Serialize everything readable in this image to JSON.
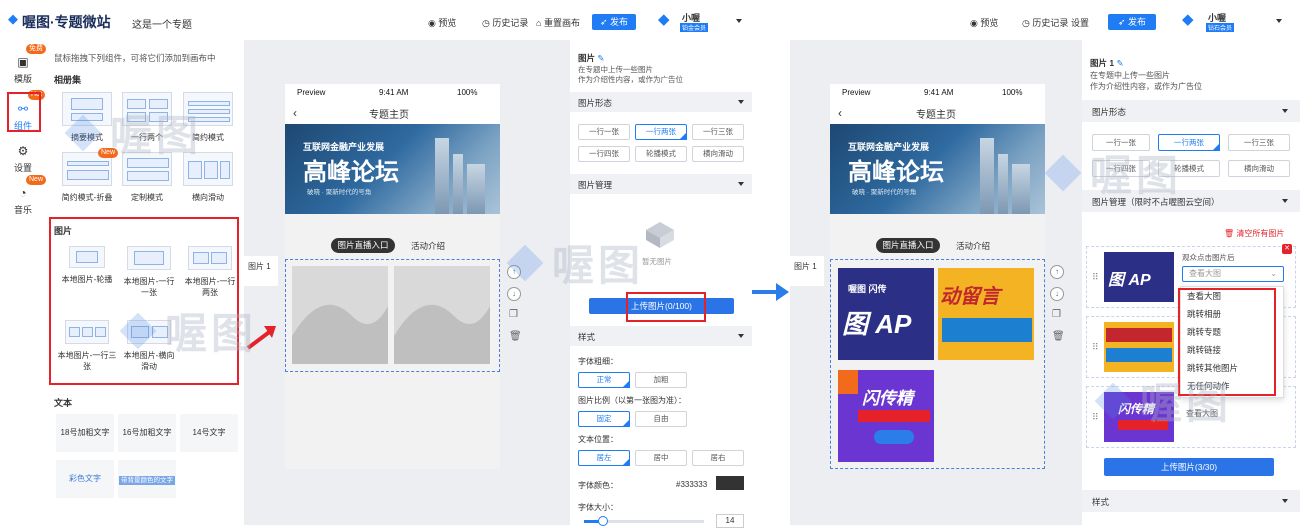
{
  "left_screen": {
    "logo": "喔图·专题微站",
    "page_title": "这是一个专题",
    "toolbar": {
      "preview": "预览",
      "history": "历史记录",
      "reset": "重置画布",
      "publish": "发布"
    },
    "user": {
      "name": "小喔",
      "tier": "铂金会员"
    },
    "nav": [
      {
        "label": "模版",
        "badge": "免费"
      },
      {
        "label": "组件",
        "badge": "Hot"
      },
      {
        "label": "设置",
        "badge": ""
      },
      {
        "label": "音乐",
        "badge": "New"
      }
    ],
    "hint": "鼠标拖拽下列组件，可将它们添加到画布中",
    "groups": {
      "album": {
        "title": "相册集",
        "tiles": [
          "摘要模式",
          "一行两个",
          "简约模式",
          "简约模式-折叠",
          "定制模式",
          "横向滑动"
        ],
        "new_badge": "New"
      },
      "image": {
        "title": "图片",
        "tiles": [
          "本地图片-轮播",
          "本地图片-一行一张",
          "本地图片-一行两张",
          "本地图片-一行三张",
          "本地图片-横向滑动"
        ]
      },
      "text": {
        "title": "文本",
        "tiles": [
          "18号加粗文字",
          "16号加粗文字",
          "14号文字",
          "彩色文字",
          "带背景颜色的文字"
        ]
      }
    },
    "canvas_tag": "图片 1",
    "phone": {
      "carrier": "Preview",
      "time": "9:41 AM",
      "battery": "100%",
      "title": "专题主页",
      "banner_sub": "互联网金融产业发展",
      "banner_main": "高峰论坛",
      "banner_tag": "破晓 · 聚新时代的号角",
      "tabs": [
        "图片直播入口",
        "活动介绍"
      ]
    },
    "props": {
      "title": "图片",
      "desc1": "在专题中上传一些图片",
      "desc2": "作为介绍性内容，或作为广告位",
      "form_label": "图片形态",
      "forms": [
        "一行一张",
        "一行两张",
        "一行三张",
        "一行四张",
        "轮播模式",
        "横向滑动"
      ],
      "manage_label": "图片管理",
      "empty": "暂无图片",
      "upload": "上传图片(0/100)",
      "style_label": "样式",
      "weight_label": "字体粗细：",
      "weights": [
        "正常",
        "加粗"
      ],
      "ratio_label": "图片比例（以第一张图为准）：",
      "ratios": [
        "固定",
        "自由"
      ],
      "pos_label": "文本位置：",
      "positions": [
        "居左",
        "居中",
        "居右"
      ],
      "color_label": "字体颜色：",
      "color_value": "#333333",
      "size_label": "字体大小：",
      "size_value": "14"
    }
  },
  "right_screen": {
    "toolbar": {
      "preview": "预览",
      "history": "历史记录",
      "settings": "设置",
      "publish": "发布"
    },
    "user": {
      "name": "小喔",
      "tier": "钻石会员"
    },
    "canvas_tag": "图片 1",
    "phone": {
      "carrier": "Preview",
      "time": "9:41 AM",
      "battery": "100%",
      "title": "专题主页",
      "banner_sub": "互联网金融产业发展",
      "banner_main": "高峰论坛",
      "banner_tag": "破晓 · 聚新时代的号角",
      "tabs": [
        "图片直播入口",
        "活动介绍"
      ],
      "cards": [
        "喔图 闪传",
        "动留言",
        "闪传精"
      ]
    },
    "props": {
      "title": "图片 1",
      "desc1": "在专题中上传一些图片",
      "desc2": "作为介绍性内容，或作为广告位",
      "form_label": "图片形态",
      "forms": [
        "一行一张",
        "一行两张",
        "一行三张",
        "一行四张",
        "轮播模式",
        "横向滑动"
      ],
      "manage_label": "图片管理（限时不占喔图云空间）",
      "clear_all": "清空所有图片",
      "after_click": "观众点击图片后",
      "select_value": "查看大图",
      "menu": [
        "查看大图",
        "跳转相册",
        "跳转专题",
        "跳转链接",
        "跳转其他图片",
        "无任何动作"
      ],
      "select_value_2": "查看大图",
      "upload": "上传图片(3/30)",
      "style_label": "样式"
    }
  },
  "watermark": "喔图"
}
